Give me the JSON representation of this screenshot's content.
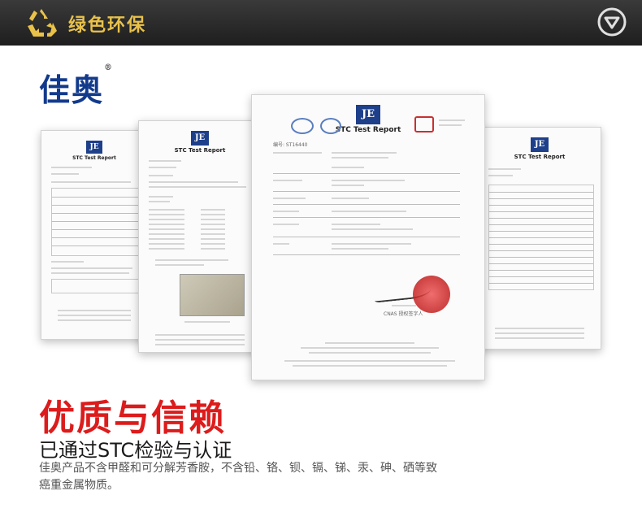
{
  "header": {
    "title": "绿色环保",
    "recycle_icon": "recycle-icon",
    "menu_icon": "chevron-down-circle-icon",
    "accent_color": "#e9c24a"
  },
  "brand": {
    "name": "佳奥",
    "mark": "®"
  },
  "documents": [
    {
      "logo": "JE",
      "title": "STC Test Report"
    },
    {
      "logo": "JE",
      "title": "STC Test Report"
    },
    {
      "logo": "JE",
      "title": "STC Test Report",
      "no_label": "编号: ST16440",
      "signature_text": "CNAS 授权签字人"
    },
    {
      "logo": "JE",
      "title": "STC Test Report"
    }
  ],
  "headline": "优质与信赖",
  "subheadline": "已通过STC检验与认证",
  "description": "佳奥产品不含甲醛和可分解芳香胺，不含铅、铬、钡、镉、锑、汞、砷、硒等致癌重金属物质。",
  "colors": {
    "headline": "#dc1c1c",
    "brand": "#123a8c",
    "topbar": "#2a2a2a"
  }
}
